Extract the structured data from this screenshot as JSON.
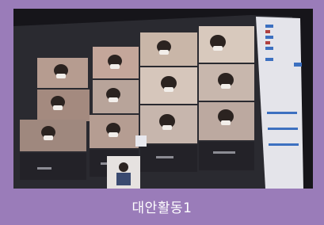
{
  "caption": "대안활동1",
  "colors": {
    "frame_purple": "#9a7cb9",
    "screen_dark": "#1b1a1f",
    "caption_text": "#ffffff"
  },
  "photo": {
    "description_icon": "video-conference-photo-icon"
  }
}
